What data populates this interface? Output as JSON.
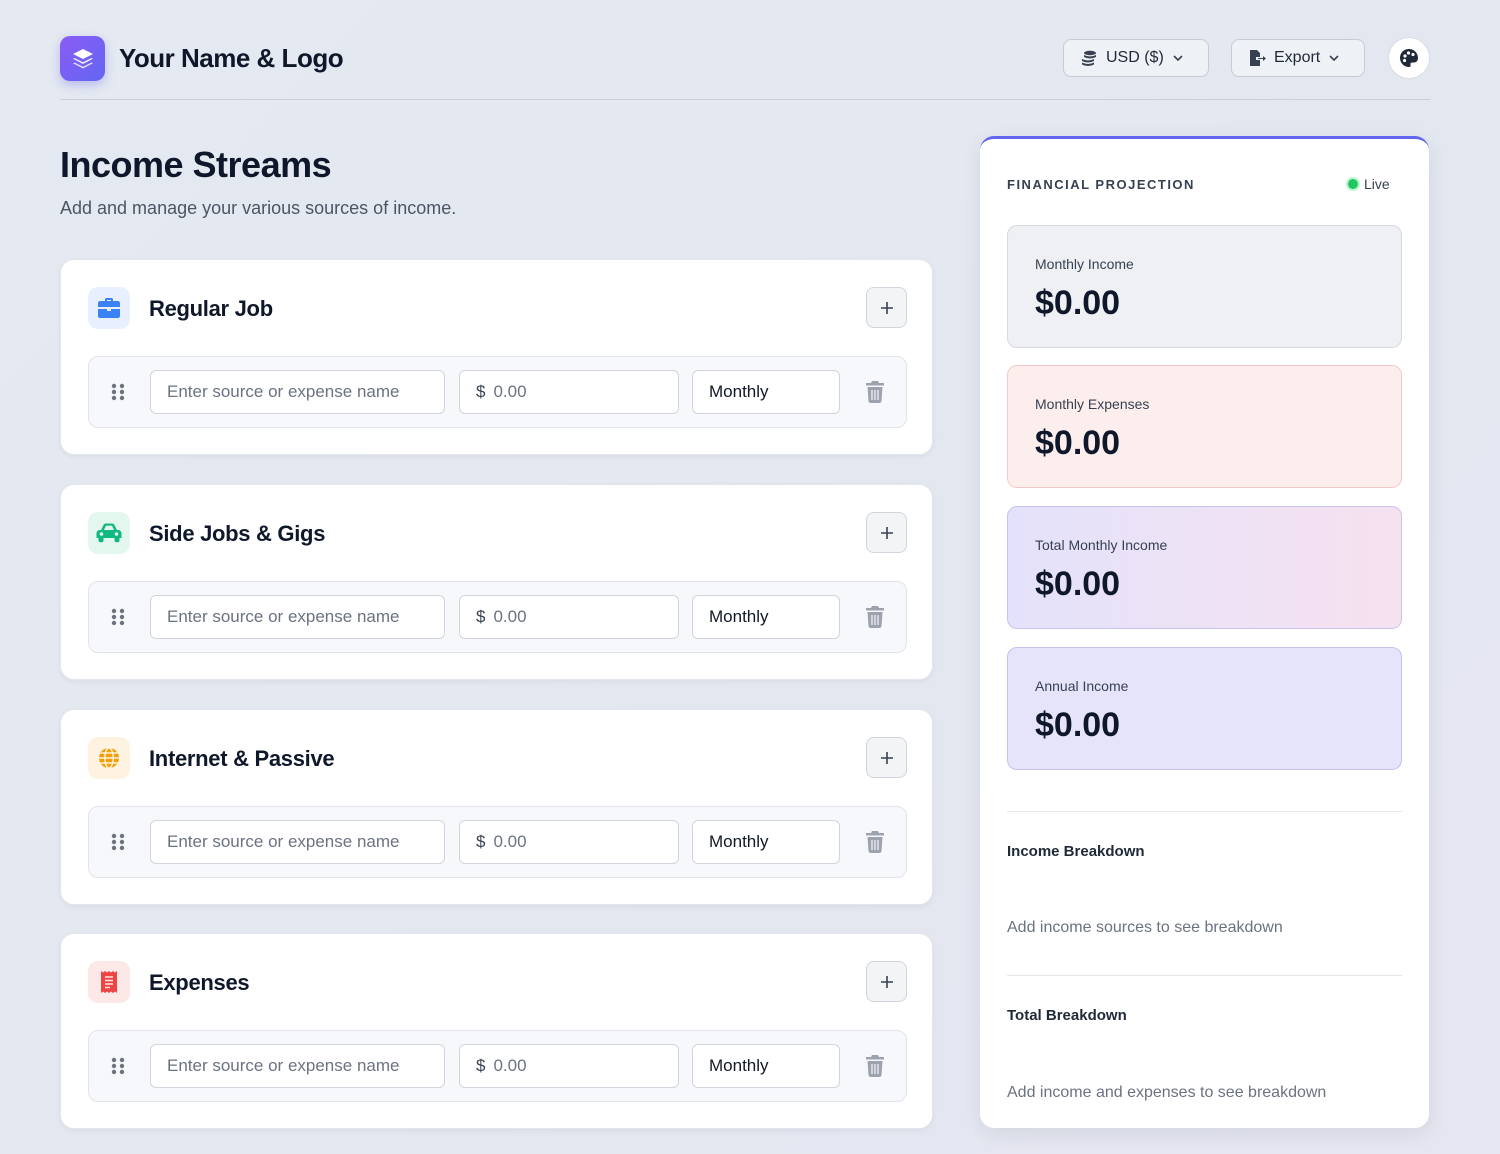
{
  "header": {
    "brand_name": "Your Name & Logo",
    "currency_label": "USD ($)",
    "export_label": "Export"
  },
  "page": {
    "title": "Income Streams",
    "subtitle": "Add and manage your various sources of income."
  },
  "categories": [
    {
      "title": "Regular Job",
      "icon": "briefcase-icon",
      "color": "#3b82f6",
      "icon_bg": "#e8efff"
    },
    {
      "title": "Side Jobs & Gigs",
      "icon": "car-icon",
      "color": "#10b981",
      "icon_bg": "#e3f7ef"
    },
    {
      "title": "Internet & Passive",
      "icon": "globe-icon",
      "color": "#f59e0b",
      "icon_bg": "#fdf3e0"
    },
    {
      "title": "Expenses",
      "icon": "receipt-icon",
      "color": "#ef4444",
      "icon_bg": "#fde8e8"
    }
  ],
  "entry_row": {
    "name_placeholder": "Enter source or expense name",
    "currency_symbol": "$",
    "amount_placeholder": "0.00",
    "frequency": "Monthly"
  },
  "projection": {
    "title": "FINANCIAL PROJECTION",
    "live_label": "Live",
    "stats": [
      {
        "label": "Monthly Income",
        "value": "$0.00"
      },
      {
        "label": "Monthly Expenses",
        "value": "$0.00"
      },
      {
        "label": "Total Monthly Income",
        "value": "$0.00"
      },
      {
        "label": "Annual Income",
        "value": "$0.00"
      }
    ],
    "income_breakdown_title": "Income Breakdown",
    "income_breakdown_empty": "Add income sources to see breakdown",
    "total_breakdown_title": "Total Breakdown",
    "total_breakdown_empty": "Add income and expenses to see breakdown"
  },
  "colors": {
    "accent": "#6366f1",
    "live": "#22c55e"
  }
}
